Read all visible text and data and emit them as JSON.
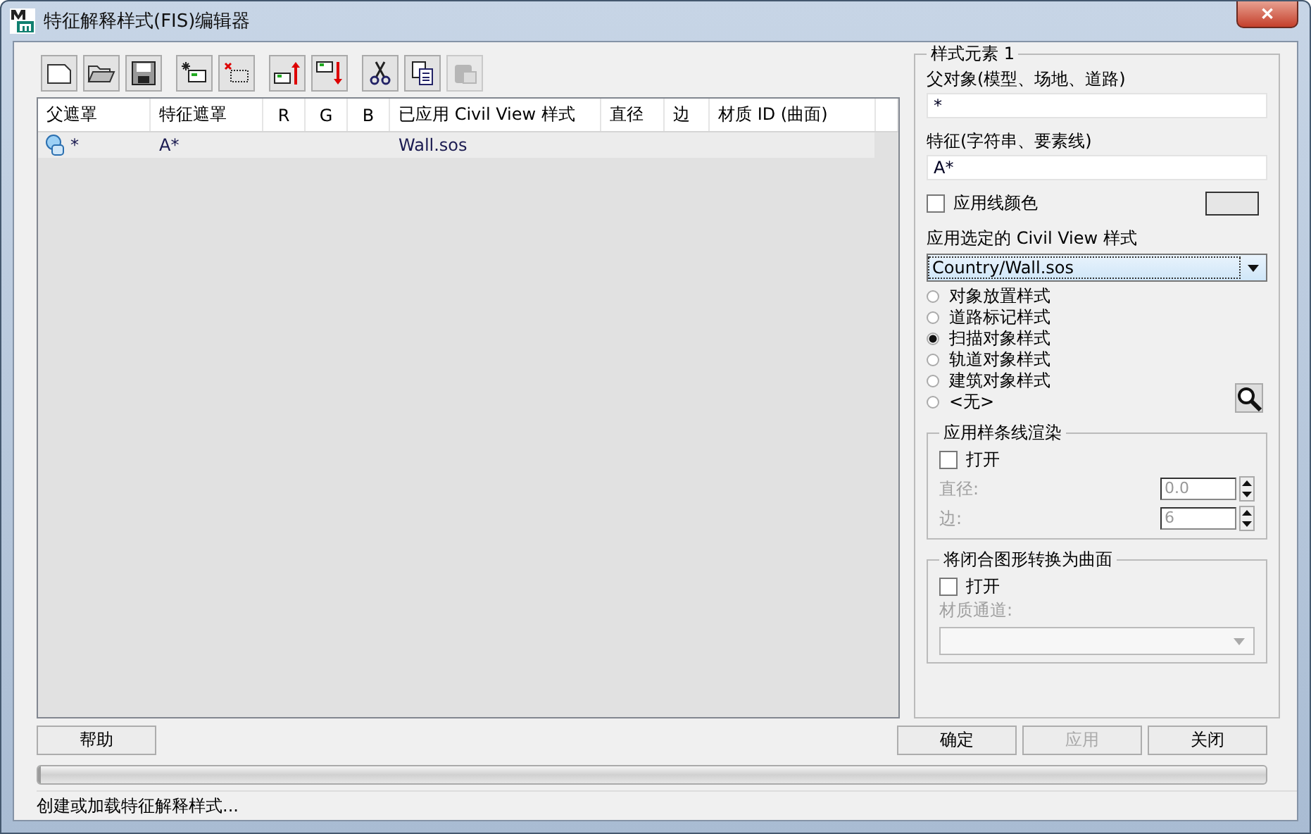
{
  "window": {
    "title": "特征解释样式(FIS)编辑器",
    "close": "✕"
  },
  "toolbar": [
    [
      {
        "kind": "new",
        "disabled": false
      },
      {
        "kind": "open",
        "disabled": false
      },
      {
        "kind": "save",
        "disabled": false
      }
    ],
    [
      {
        "kind": "add",
        "disabled": false
      },
      {
        "kind": "delete",
        "disabled": false
      }
    ],
    [
      {
        "kind": "up",
        "disabled": false
      },
      {
        "kind": "down",
        "disabled": false
      }
    ],
    [
      {
        "kind": "cut",
        "disabled": false
      },
      {
        "kind": "copy",
        "disabled": false
      },
      {
        "kind": "paste",
        "disabled": true
      }
    ]
  ],
  "table": {
    "columns": [
      "父遮罩",
      "特征遮罩",
      "R",
      "G",
      "B",
      "已应用 Civil View 样式",
      "直径",
      "边",
      "材质 ID (曲面)"
    ],
    "rows": [
      {
        "parent_mask": "*",
        "feature_mask": "A*",
        "style": "Wall.sos",
        "selected": false
      }
    ]
  },
  "panel": {
    "title": "样式元素 1",
    "parent_label": "父对象(模型、场地、道路)",
    "parent_value": "*",
    "feature_label": "特征(字符串、要素线)",
    "feature_value": "A*",
    "line_color": {
      "label": "应用线颜色",
      "checked": false,
      "color": "#e6e6e6"
    },
    "style_label": "应用选定的 Civil View 样式",
    "style_value": "Country/Wall.sos",
    "radios": [
      {
        "label": "对象放置样式",
        "selected": false
      },
      {
        "label": "道路标记样式",
        "selected": false
      },
      {
        "label": "扫描对象样式",
        "selected": true
      },
      {
        "label": "轨道对象样式",
        "selected": false
      },
      {
        "label": "建筑对象样式",
        "selected": false
      },
      {
        "label": "<无>",
        "selected": false
      }
    ],
    "spline": {
      "title": "应用样条线渲染",
      "open_label": "打开",
      "checked": false,
      "diameter_label": "直径:",
      "diameter": "0.0",
      "sides_label": "边:",
      "sides": "6",
      "disabled": true
    },
    "surface": {
      "title": "将闭合图形转换为曲面",
      "open_label": "打开",
      "checked": false,
      "channel_label": "材质通道:",
      "disabled": true
    }
  },
  "buttons": [
    {
      "label": "帮助",
      "disabled": false
    },
    {
      "label": "确定",
      "disabled": false
    },
    {
      "label": "应用",
      "disabled": true
    },
    {
      "label": "关闭",
      "disabled": false
    }
  ],
  "progress": {
    "level": 0
  },
  "status_bar": "创建或加载特征解释样式..."
}
